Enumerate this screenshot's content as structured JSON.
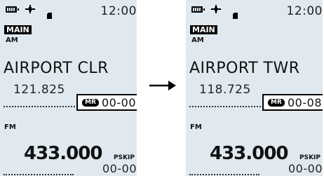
{
  "screens": [
    {
      "status": {
        "clock": "12:00",
        "icons": [
          "battery-icon",
          "gps-icon",
          "sd-card-icon"
        ]
      },
      "band_label": "MAIN",
      "mode_a": "AM",
      "channel_name": "AIRPORT CLR",
      "frequency_a": "121.825",
      "memory": {
        "badge": "MR",
        "number": "00-00"
      },
      "mode_b": "FM",
      "frequency_b": "433.000",
      "skip_label": "PSKIP",
      "memory_b_number": "00-00"
    },
    {
      "status": {
        "clock": "12:00",
        "icons": [
          "battery-icon",
          "gps-icon",
          "sd-card-icon"
        ]
      },
      "band_label": "MAIN",
      "mode_a": "AM",
      "channel_name": "AIRPORT TWR",
      "frequency_a": "118.725",
      "memory": {
        "badge": "MR",
        "number": "00-08"
      },
      "mode_b": "FM",
      "frequency_b": "433.000",
      "skip_label": "PSKIP",
      "memory_b_number": "00-00"
    }
  ],
  "arrow": {
    "icon": "right-arrow-icon",
    "color": "#000000"
  },
  "colors": {
    "screen_background": "#dfe9ef",
    "highlight_box": "#ffffff"
  }
}
